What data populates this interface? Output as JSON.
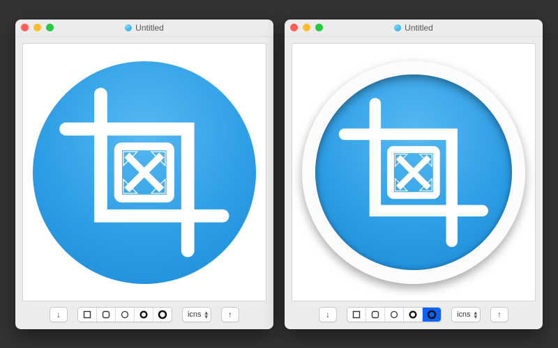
{
  "windows": [
    {
      "title": "Untitled",
      "style_selected_index": 3,
      "format_value": "icns",
      "icon_style": "flat"
    },
    {
      "title": "Untitled",
      "style_selected_index": 4,
      "format_value": "icns",
      "icon_style": "ring"
    }
  ],
  "toolbar": {
    "import_tooltip": "Import",
    "export_tooltip": "Export",
    "format_label": "icns"
  },
  "shape_options": [
    "square-outline",
    "rounded-square",
    "circle-thin",
    "circle-bold",
    "circle-extra"
  ]
}
